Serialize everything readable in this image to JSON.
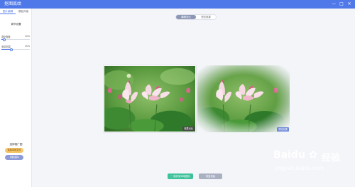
{
  "window": {
    "title": "抠图底纹",
    "controls": {
      "minimize": "—",
      "maximize": "□",
      "close": "✕"
    }
  },
  "sidebar": {
    "tabs": [
      {
        "label": "图片编辑",
        "active": true
      },
      {
        "label": "模板风格",
        "active": false
      }
    ],
    "section_title": "调节设置",
    "sliders": [
      {
        "label": "虚化程度",
        "value_text": "10%",
        "value": 0.1
      },
      {
        "label": "渐变范围",
        "value_text": "35%",
        "value": 0.35
      }
    ],
    "footer_title": "选择推广图",
    "buttons": {
      "primary": "选择本地文件",
      "secondary": "重新选择"
    }
  },
  "toolbar": {
    "toggle": [
      {
        "label": "编辑对比",
        "active": true
      },
      {
        "label": "预览效果",
        "active": false
      }
    ]
  },
  "preview": {
    "left_badge": "效果对比",
    "right_badge": "预览效果"
  },
  "actions": {
    "save": "保存到本地图片",
    "reset": "恢复初始"
  },
  "watermark": {
    "brand": "Baidu",
    "cn": "经验",
    "url": "jingyan.baidu.com"
  },
  "colors": {
    "accent": "#4f78e8",
    "save_green": "#3ec29a",
    "badge_blue": "#6c86d8"
  }
}
